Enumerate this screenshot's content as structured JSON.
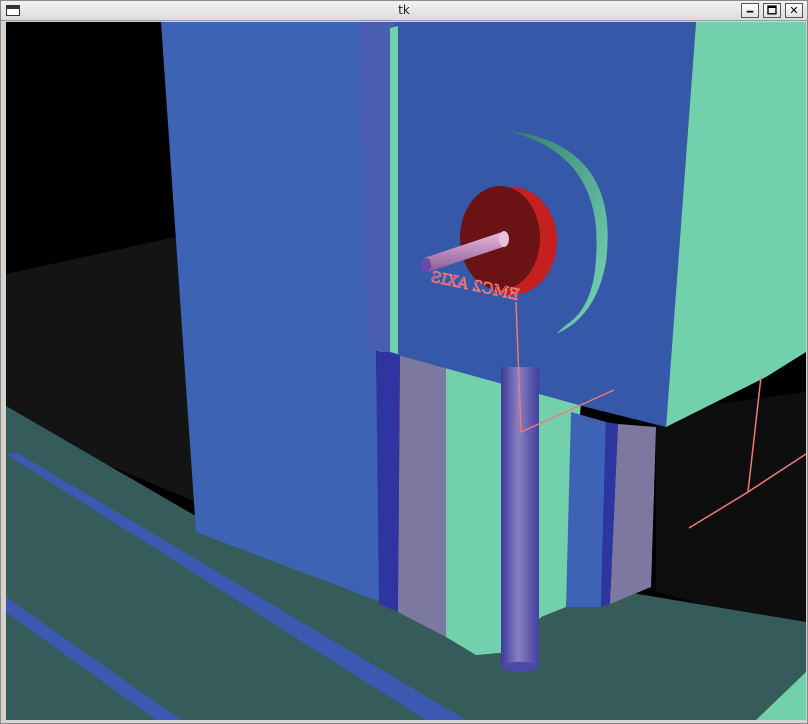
{
  "window": {
    "title": "tk",
    "buttons": {
      "minimize": "🗕",
      "maximize": "🗖",
      "close": "✕"
    }
  },
  "scene": {
    "axis_label": "EMC2 AXIS",
    "colors": {
      "background": "#000000",
      "floor": "#355c5a",
      "rail_blue": "#3b59b0",
      "column_blue": "#3d63b5",
      "head_green": "#72d0ad",
      "spindle_red": "#6a1214",
      "tool_lavender": "#7d78a0",
      "limit_lines": "#f07878"
    }
  }
}
